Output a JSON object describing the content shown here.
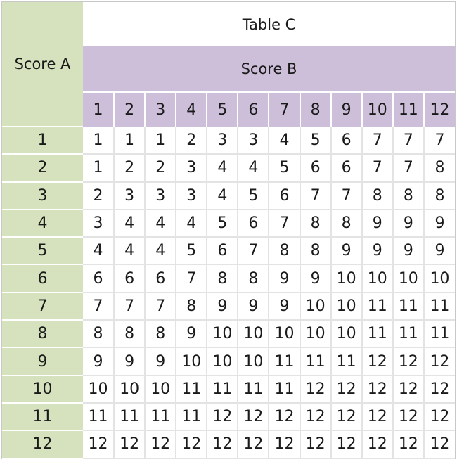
{
  "table": {
    "title": "Table C",
    "row_header_label": "Score A",
    "column_header_label": "Score B",
    "columns": [
      "1",
      "2",
      "3",
      "4",
      "5",
      "6",
      "7",
      "8",
      "9",
      "10",
      "11",
      "12"
    ],
    "rows": [
      {
        "label": "1",
        "values": [
          "1",
          "1",
          "1",
          "2",
          "3",
          "3",
          "4",
          "5",
          "6",
          "7",
          "7",
          "7"
        ]
      },
      {
        "label": "2",
        "values": [
          "1",
          "2",
          "2",
          "3",
          "4",
          "4",
          "5",
          "6",
          "6",
          "7",
          "7",
          "8"
        ]
      },
      {
        "label": "3",
        "values": [
          "2",
          "3",
          "3",
          "3",
          "4",
          "5",
          "6",
          "7",
          "7",
          "8",
          "8",
          "8"
        ]
      },
      {
        "label": "4",
        "values": [
          "3",
          "4",
          "4",
          "4",
          "5",
          "6",
          "7",
          "8",
          "8",
          "9",
          "9",
          "9"
        ]
      },
      {
        "label": "5",
        "values": [
          "4",
          "4",
          "4",
          "5",
          "6",
          "7",
          "8",
          "8",
          "9",
          "9",
          "9",
          "9"
        ]
      },
      {
        "label": "6",
        "values": [
          "6",
          "6",
          "6",
          "7",
          "8",
          "8",
          "9",
          "9",
          "10",
          "10",
          "10",
          "10"
        ]
      },
      {
        "label": "7",
        "values": [
          "7",
          "7",
          "7",
          "8",
          "9",
          "9",
          "9",
          "10",
          "10",
          "11",
          "11",
          "11"
        ]
      },
      {
        "label": "8",
        "values": [
          "8",
          "8",
          "8",
          "9",
          "10",
          "10",
          "10",
          "10",
          "10",
          "11",
          "11",
          "11"
        ]
      },
      {
        "label": "9",
        "values": [
          "9",
          "9",
          "9",
          "10",
          "10",
          "10",
          "11",
          "11",
          "11",
          "12",
          "12",
          "12"
        ]
      },
      {
        "label": "10",
        "values": [
          "10",
          "10",
          "10",
          "11",
          "11",
          "11",
          "11",
          "12",
          "12",
          "12",
          "12",
          "12"
        ]
      },
      {
        "label": "11",
        "values": [
          "11",
          "11",
          "11",
          "11",
          "12",
          "12",
          "12",
          "12",
          "12",
          "12",
          "12",
          "12"
        ]
      },
      {
        "label": "12",
        "values": [
          "12",
          "12",
          "12",
          "12",
          "12",
          "12",
          "12",
          "12",
          "12",
          "12",
          "12",
          "12"
        ]
      }
    ]
  },
  "colors": {
    "row_header_bg": "#d6e2bd",
    "column_header_bg": "#cdbfda",
    "cell_bg": "#ffffff"
  }
}
